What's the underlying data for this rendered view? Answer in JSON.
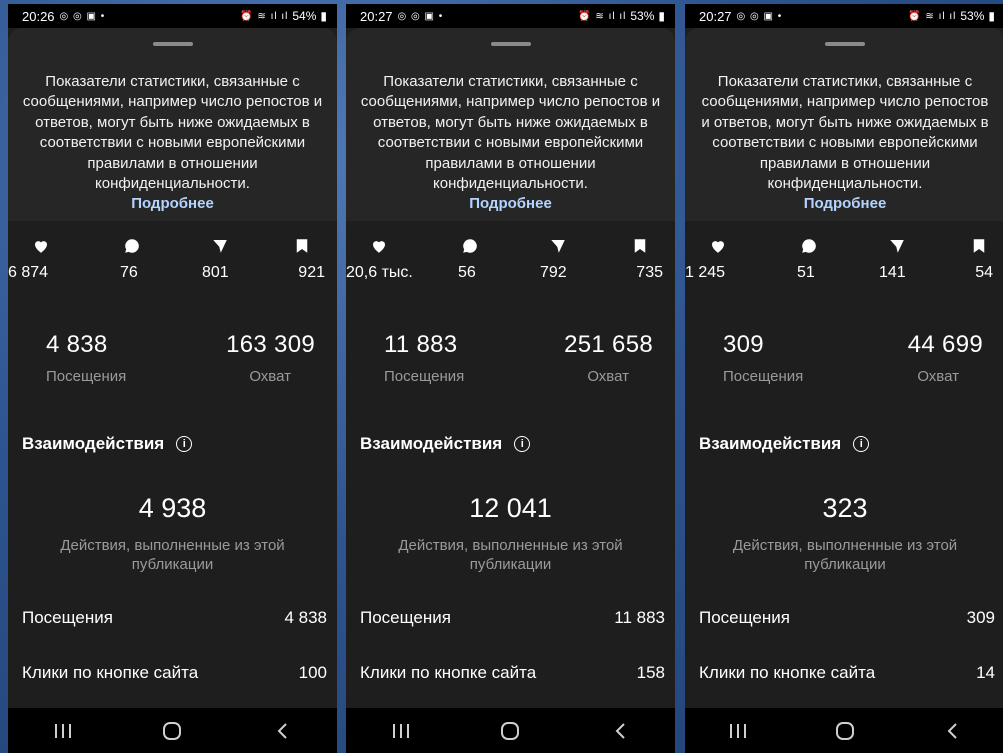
{
  "common": {
    "notice": "Показатели статистики, связанные с сообщениями, например число репостов и ответов, могут быть ниже ожидаемых в соответствии с новыми европейскими правилами в отношении конфиденциальности.",
    "more_link": "Подробнее",
    "visits_label": "Посещения",
    "reach_label": "Охват",
    "interactions_title": "Взаимодействия",
    "info_icon": "ⓘ",
    "interactions_desc": "Действия, выполненные из этой публикации",
    "row_visits_label": "Посещения",
    "row_site_clicks_label": "Клики по кнопке сайта",
    "icons": [
      "heart-icon",
      "comment-icon",
      "send-icon",
      "bookmark-icon"
    ],
    "nav": [
      "|||",
      "○",
      "<"
    ]
  },
  "phones": [
    {
      "time": "20:26",
      "battery": "54%",
      "likes": "6 874",
      "comments": "76",
      "shares": "801",
      "saves": "921",
      "visits": "4 838",
      "reach": "163 309",
      "interactions": "4 938",
      "row_visits": "4 838",
      "row_site_clicks": "100"
    },
    {
      "time": "20:27",
      "battery": "53%",
      "likes": "20,6 тыс.",
      "comments": "56",
      "shares": "792",
      "saves": "735",
      "visits": "11 883",
      "reach": "251 658",
      "interactions": "12 041",
      "row_visits": "11 883",
      "row_site_clicks": "158"
    },
    {
      "time": "20:27",
      "battery": "53%",
      "likes": "1 245",
      "comments": "51",
      "shares": "141",
      "saves": "54",
      "visits": "309",
      "reach": "44 699",
      "interactions": "323",
      "row_visits": "309",
      "row_site_clicks": "14"
    }
  ]
}
